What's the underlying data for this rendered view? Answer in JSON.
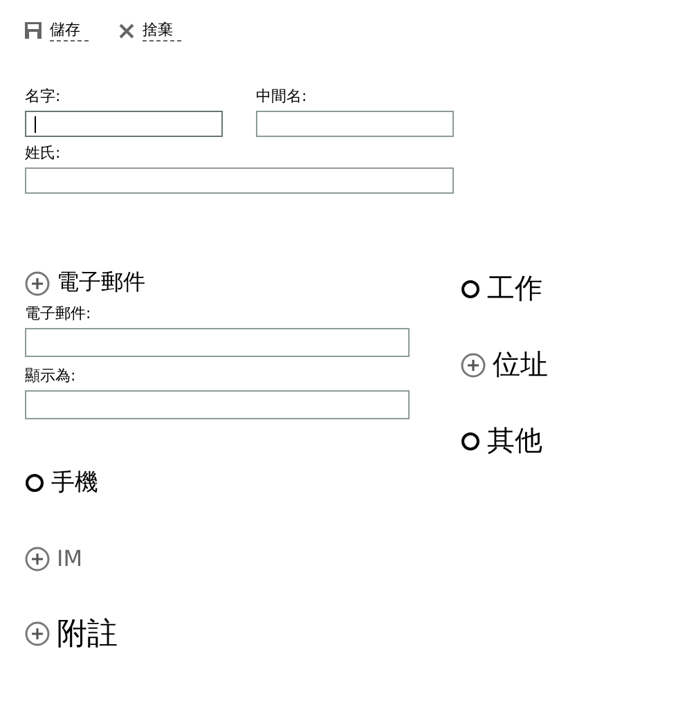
{
  "toolbar": [
    {
      "label": "儲存",
      "kind": "save"
    },
    {
      "label": "捨棄",
      "kind": "close"
    }
  ],
  "name_fields": [
    {
      "label": "名字:",
      "focused": true
    },
    {
      "label": "中間名:",
      "focused": false
    },
    {
      "label": "姓氏:",
      "focused": false
    }
  ],
  "left_sections": [
    {
      "title": "電子郵件",
      "kind": "plus",
      "disabled": false,
      "fields": [
        {
          "label": "電子郵件:"
        },
        {
          "label": "顯示為:"
        }
      ]
    },
    {
      "title": "手機",
      "kind": "circle",
      "disabled": false
    },
    {
      "title": "IM",
      "kind": "plus",
      "disabled": true
    },
    {
      "title": "附註",
      "kind": "plus",
      "disabled": false
    }
  ],
  "right_sections": [
    {
      "title": "工作",
      "kind": "circle",
      "disabled": false
    },
    {
      "title": "位址",
      "kind": "plus",
      "disabled": false
    },
    {
      "title": "其他",
      "kind": "circle",
      "disabled": false
    }
  ]
}
